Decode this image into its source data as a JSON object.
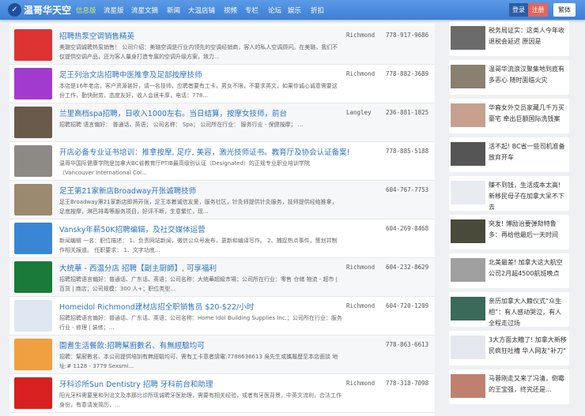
{
  "nav": {
    "logo": "温哥华天空",
    "items": [
      "信息版",
      "流星版",
      "流星文摘",
      "新闻",
      "大温店铺",
      "视频",
      "专栏",
      "论坛",
      "娱乐",
      "折扣"
    ],
    "login": "登录",
    "register": "注册",
    "traditional": "繁体"
  },
  "listings": [
    {
      "title": "招聘热泵空调销售精英",
      "desc": "美璐空调诚聘热泵销售！ 公司介绍：美璐空调是行业内领先的空调经销商，客人的私人空调顾问。在美璐，我们不仅提供空调产品，还为客人量身打造专属的空调升级方案，致力...",
      "location": "Richmond",
      "phone": "778-917-9686",
      "thumb": "#d33"
    },
    {
      "title": "足王列治文店招聘中医推拿及足部按摩技师",
      "desc": "本店是16年老店，客户资源甚好，请一名技师，应聘者要有工卡，男女不限，不要求英文，如果你诚心诚意需要这份工作，勤快耐劳，态度友好，收入会很丰厚，电话：778...",
      "location": "Richmond",
      "phone": "778-882-3689",
      "thumb": "#a23ad0"
    },
    {
      "title": "兰里高档spa招聘，日收入1000左右。当日结算，按摩女技师，前台",
      "desc": "招聘招聘 语言偏好： 普通话、英语； 公司名称： Spa； 公司所在行业： 服务行业 - 保健按摩； ...",
      "location": "Langley",
      "phone": "236-881-1825",
      "thumb": "#6a5a4a"
    },
    {
      "title": "开店必备专业证书培训：推拿按摩, 足疗, 美容，激光技师证书。教育厅及协会认证备案!",
      "desc": "温哥华国际健康学院是加拿大BC省教育厅PTIB最高级别认证（Designated）的正规专业职业培训学院（Vancouver International Col...",
      "location": "",
      "phone": "778-885-5188",
      "thumb": "#8d8a86"
    },
    {
      "title": "足王第21家新店Broadway开张诚聘技师",
      "desc": "足王Broadway第21家新店即将开张，足王本着诚信友爱，服务社区，针灸师提供针灸服务，技师提供经络推拿，足底按摩，淋巴排毒等服务项目，好评不断，生意繁忙，现...",
      "location": "",
      "phone": "604-767-7753",
      "thumb": "#9b8a70"
    },
    {
      "title": "Vansky年薪50K招聘编辑，及社交媒体运营",
      "desc": "新闻编辑 一名：职位描述： 1、负责网站新闻，微信公众号发布，更新和编译写作。 2、捕捉热点事件，策划并制作相关报道。 任职要求： 1、文字功底...",
      "location": "",
      "phone": "604-269-8468",
      "thumb": "#3b86d4"
    },
    {
      "title": "大统華 - 西温分店 招聘【副主厨師】, 可享福利",
      "desc": "招聘招聘语言偏好：普通话、广东话、英语；公司名称：大统華超級市場；公司所在行业：零售 仓储 物流 - 超市 | 百货 | 商店；公司规模：300 人+；职位类型...",
      "location": "Richmond",
      "phone": "604-232-8629",
      "thumb": "#1a7a3a"
    },
    {
      "title": "Homeidol Richmond建材店招全职销售员 $20-$22/小时",
      "desc": "招聘招聘语言偏好：普通话、广东话、英语；公司名称：Home Idol Building Supplies Inc.；公司所在行业：服务行业 - 修理 | 装修；...",
      "location": "Richmond",
      "phone": "604-720-1209",
      "thumb": "#dfe8f2"
    },
    {
      "title": "園耆生活餐飲:招聘幫廚數名、有無經驗均可",
      "desc": "招聘：幫廚數名、本公司提供培訓有無經驗均可、需有工卡意者請電:7788636613 吳先生或攜履歷至本店面談 地址:# 1128 - 3779 Sexsmi...",
      "location": "",
      "phone": "778-863-6613",
      "thumb": "#f0a040"
    },
    {
      "title": "牙科诊所Sun Dentistry 招聘 牙科前台和助理",
      "desc": "阳光牙科需要里和列治文及本那比诊所现诚聘牙医助理，需要有相关经验，或者有牙医背景，中英文流利，合法工作身份，有意请发简历，...",
      "location": "Richmond",
      "phone": "778-318-7098",
      "thumb": "#d82020"
    }
  ],
  "sidebar": [
    {
      "title": "税务局证实：这类人今年收退税会延迟 原因是",
      "img": "#6b6b6b"
    },
    {
      "title": "温哥华流浪汉聚集地到底有多恶心 随时面临火灾",
      "img": "#8a8070"
    },
    {
      "title": "华裔女外交员家藏几千万买豪宅 牵出巨额国际洗钱案",
      "img": "#c7a090"
    },
    {
      "title": "活不起! BC省一些司机准备放弃开车",
      "img": "#555"
    },
    {
      "title": "赚不到钱，生活成本太高! 新移民母子在加拿大呆不下去",
      "img": "#e8ecf0"
    },
    {
      "title": "突发! 博励治要弹劾特鲁多：再给他最后一天时间",
      "img": "#4a4a3a"
    },
    {
      "title": "北美最差! 加拿大这大航空公司2月超4500航班晚点",
      "img": "#a0a0a0"
    },
    {
      "title": "亲历加拿大入籍仪式“众生相”：有人感动哭泣，有人全程走过场",
      "img": "#3a6a5a"
    },
    {
      "title": "3大方面太糟了! 加拿大新移民疯狂吐槽 华人网友\"补刀\"",
      "img": "#e4e8ee"
    },
    {
      "title": "马蓉刚走又来了冯清，倒霉的王宝强，终究还是...",
      "img": "#c08070"
    }
  ]
}
